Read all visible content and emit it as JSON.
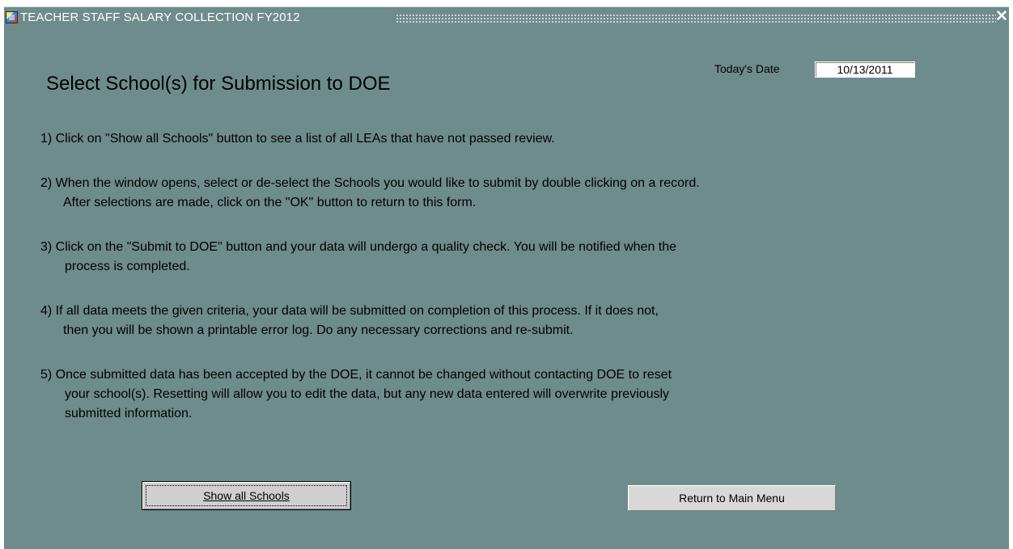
{
  "window": {
    "title": "TEACHER STAFF SALARY COLLECTION FY2012",
    "icon": "app-form-icon",
    "close_icon": "close-icon",
    "close_glyph": "✕",
    "background_color": "#6e8c8c"
  },
  "header": {
    "date_label": "Today's Date",
    "date_value": "10/13/2011",
    "page_title": "Select School(s) for Submission to DOE"
  },
  "instructions": [
    {
      "lines": [
        "1)  Click on \"Show all Schools\" button to see a list of all LEAs that have not passed review."
      ]
    },
    {
      "lines": [
        "2) When the window opens, select or de-select the Schools you would like to submit by double clicking on a record.",
        "After selections are made, click on the \"OK\" button to return to this form."
      ]
    },
    {
      "lines": [
        "3) Click on the \"Submit to DOE\"  button and your data will undergo a quality check.   You will be notified when the",
        "process is completed."
      ]
    },
    {
      "lines": [
        "4) If all data meets the given criteria, your data will be submitted on completion of this process.  If it  does not,",
        "then you will be shown a printable error log.  Do any necessary corrections and re-submit."
      ]
    },
    {
      "lines": [
        "5) Once submitted data has been accepted by the DOE, it cannot be changed without contacting DOE to reset",
        "your school(s).  Resetting will allow you to edit the data, but any new data entered will overwrite previously",
        "submitted information."
      ]
    }
  ],
  "buttons": {
    "show_all_schools": "Show all Schools",
    "return_main_menu": "Return to Main Menu"
  }
}
